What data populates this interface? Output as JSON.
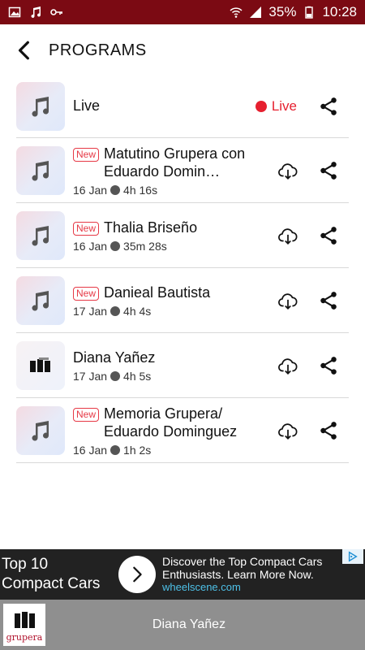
{
  "status_bar": {
    "battery_percent": "35%",
    "time": "10:28",
    "left_icons": [
      "image-icon",
      "music-note-icon",
      "key-icon"
    ],
    "right_icons": [
      "wifi-icon",
      "signal-icon"
    ]
  },
  "header": {
    "title": "PROGRAMS"
  },
  "live_row": {
    "title": "Live",
    "live_label": "Live"
  },
  "programs": [
    {
      "new_label": "New",
      "title": "Matutino Grupera con Eduardo Domin…",
      "date": "16 Jan",
      "duration": "4h 16s",
      "thumb": "music"
    },
    {
      "new_label": "New",
      "title": "Thalia Briseño",
      "date": "16 Jan",
      "duration": "35m 28s",
      "thumb": "music"
    },
    {
      "new_label": "New",
      "title": "Danieal Bautista",
      "date": "17 Jan",
      "duration": "4h 4s",
      "thumb": "music"
    },
    {
      "new_label": "",
      "title": "Diana Yañez",
      "date": "17 Jan",
      "duration": "4h 5s",
      "thumb": "logo"
    },
    {
      "new_label": "New",
      "title": "Memoria Grupera/ Eduardo Dominguez",
      "date": "16 Jan",
      "duration": "1h 2s",
      "thumb": "music"
    }
  ],
  "ad": {
    "left_text_line1": "Top 10",
    "left_text_line2": "Compact Cars",
    "right_text_line1": "Discover the Top Compact Cars",
    "right_text_line2": "Enthusiasts. Learn More Now.",
    "url": "wheelscene.com"
  },
  "player": {
    "title": "Diana Yañez",
    "logo_text": "grupera"
  },
  "colors": {
    "status_bar": "#7b0a13",
    "live_red": "#e6202f",
    "new_badge": "#e63946",
    "player_bg": "#8f8f8f"
  }
}
